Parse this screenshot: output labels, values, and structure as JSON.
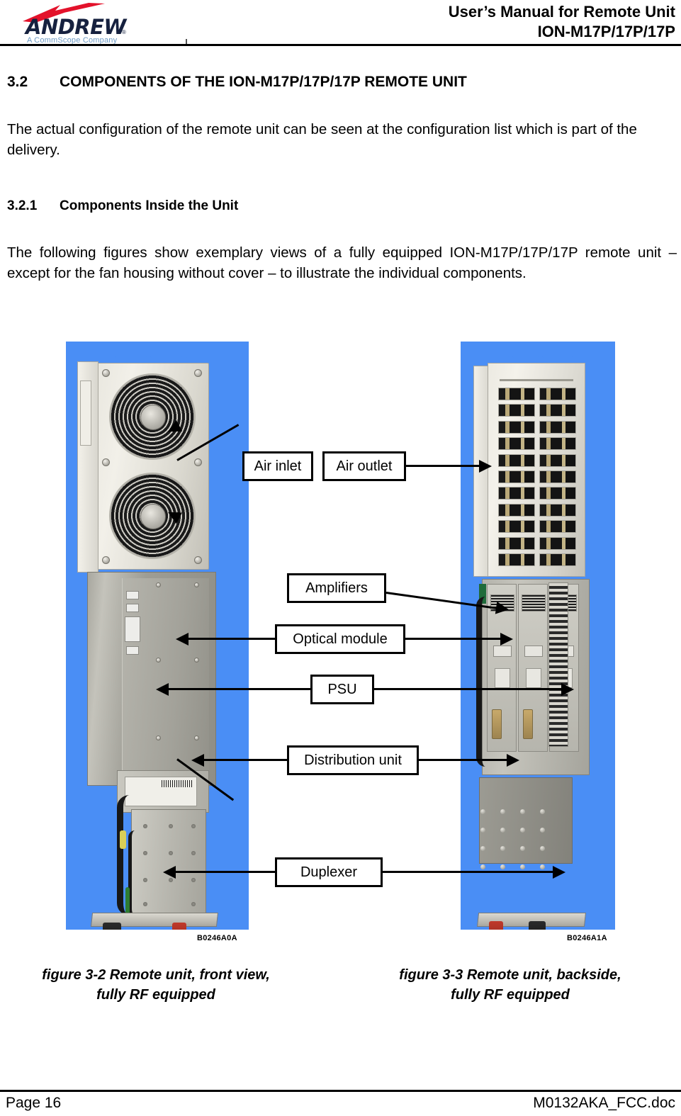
{
  "header": {
    "logo": {
      "wordmark": "ANDREW",
      "registered": "®",
      "tagline": "A CommScope Company"
    },
    "title_line1": "User’s Manual for Remote Unit",
    "title_line2": "ION-M17P/17P/17P"
  },
  "content": {
    "section_number": "3.2",
    "section_title": "COMPONENTS OF THE ION-M17P/17P/17P REMOTE UNIT",
    "paragraph_1": "The actual configuration of the remote unit can be seen at the configuration list which is part of the delivery.",
    "subsection_number": "3.2.1",
    "subsection_title": "Components Inside the Unit",
    "paragraph_2": "The following figures show exemplary views of a fully equipped ION-M17P/17P/17P remote unit – except for the fan housing without cover – to illustrate the individual components."
  },
  "figure": {
    "callouts": [
      {
        "label": "Air inlet"
      },
      {
        "label": "Air outlet"
      },
      {
        "label": "Amplifiers"
      },
      {
        "label": "Optical module"
      },
      {
        "label": "PSU"
      },
      {
        "label": "Distribution unit"
      },
      {
        "label": "Duplexer"
      }
    ],
    "photo_left": {
      "id": "B0246A0A",
      "caption_line1": "figure 3-2 Remote unit, front view,",
      "caption_line2": "fully RF equipped",
      "background_color": "#4a8ef5"
    },
    "photo_right": {
      "id": "B0246A1A",
      "caption_line1": "figure 3-3 Remote unit, backside,",
      "caption_line2": "fully RF equipped",
      "background_color": "#4a8ef5"
    }
  },
  "footer": {
    "page_label": "Page 16",
    "document_name": "M0132AKA_FCC.doc"
  }
}
